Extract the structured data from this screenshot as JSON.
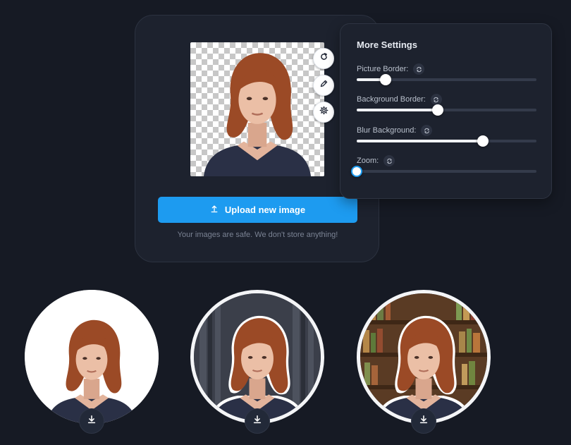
{
  "upload": {
    "button_label": "Upload new image",
    "safety_note": "Your images are safe. We don't store anything!"
  },
  "tools": {
    "icons": [
      "refresh-icon",
      "pencil-icon",
      "gear-icon"
    ]
  },
  "settings": {
    "title": "More Settings",
    "sliders": [
      {
        "label": "Picture Border:",
        "value": 0.16
      },
      {
        "label": "Background Border:",
        "value": 0.45
      },
      {
        "label": "Blur Background:",
        "value": 0.7
      },
      {
        "label": "Zoom:",
        "value": 0.0
      }
    ]
  },
  "colors": {
    "background": "#161a24",
    "card": "#1d222e",
    "accent": "#1d9bf0",
    "hair": "#9b4a26",
    "shirt": "#2a3046"
  },
  "avatars": [
    {
      "style": "plain-white-background",
      "download_icon": "download-icon"
    },
    {
      "style": "dark-curtain-background-with-white-border",
      "download_icon": "download-icon"
    },
    {
      "style": "bookshelf-background-with-white-border",
      "download_icon": "download-icon"
    }
  ]
}
